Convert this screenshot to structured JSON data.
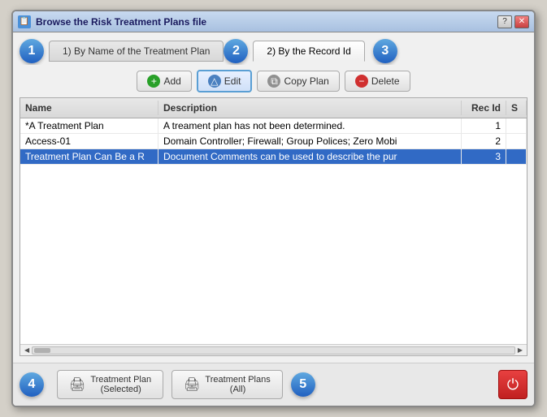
{
  "window": {
    "title": "Browse the Risk Treatment Plans file",
    "icon": "📋"
  },
  "titleButtons": {
    "help": "?",
    "close": "✕"
  },
  "tabs": [
    {
      "id": "tab1",
      "label": "1) By Name of the Treatment Plan",
      "badge": "1",
      "active": false
    },
    {
      "id": "tab2",
      "label": "2) By the Record Id",
      "badge": "2",
      "active": true
    }
  ],
  "badges": {
    "badge3": "3"
  },
  "toolbar": {
    "add_label": "Add",
    "edit_label": "Edit",
    "copy_label": "Copy Plan",
    "delete_label": "Delete"
  },
  "table": {
    "headers": [
      "Name",
      "Description",
      "Rec Id",
      "S"
    ],
    "rows": [
      {
        "name": "*A Treatment Plan",
        "description": "A treament plan has not been determined.",
        "recId": "1",
        "s": "",
        "selected": false
      },
      {
        "name": "Access-01",
        "description": "Domain Controller; Firewall; Group Polices; Zero Mobi",
        "recId": "2",
        "s": "",
        "selected": false
      },
      {
        "name": "Treatment Plan Can Be a R",
        "description": "Document Comments can be used to describe the pur",
        "recId": "3",
        "s": "",
        "selected": true
      }
    ]
  },
  "bottomButtons": {
    "treatmentPlanSelected": {
      "line1": "Treatment Plan",
      "line2": "(Selected)"
    },
    "treatmentPlansAll": {
      "line1": "Treatment Plans",
      "line2": "(All)"
    }
  }
}
